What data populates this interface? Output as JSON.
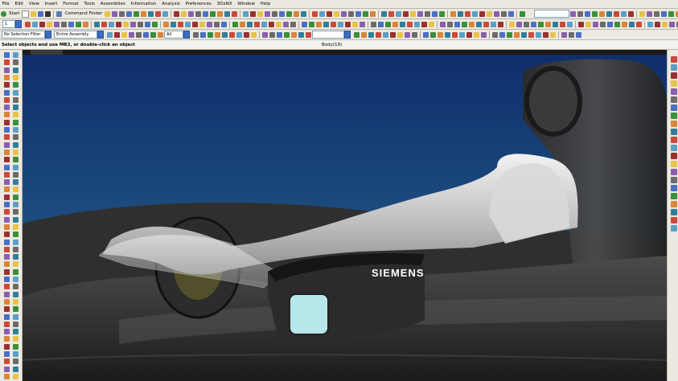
{
  "menubar": {
    "items": [
      "File",
      "Edit",
      "View",
      "Insert",
      "Format",
      "Tools",
      "Assemblies",
      "Information",
      "Analysis",
      "Preferences",
      "3DxNX",
      "Window",
      "Help"
    ]
  },
  "toolbar": {
    "start_label": "Start",
    "command_finder_label": "Command Finder"
  },
  "selection_bar": {
    "filter_value": "No Selection Filter",
    "scope_value": "Entire Assembly",
    "type_value": "All"
  },
  "status": {
    "prompt": "Select objects and use MB3, or double-click an object",
    "message": "Body(19)"
  },
  "viewport": {
    "decal_text": "SIEMENS",
    "background_top": "#0f2e6b",
    "background_bottom": "#2a6a92"
  }
}
